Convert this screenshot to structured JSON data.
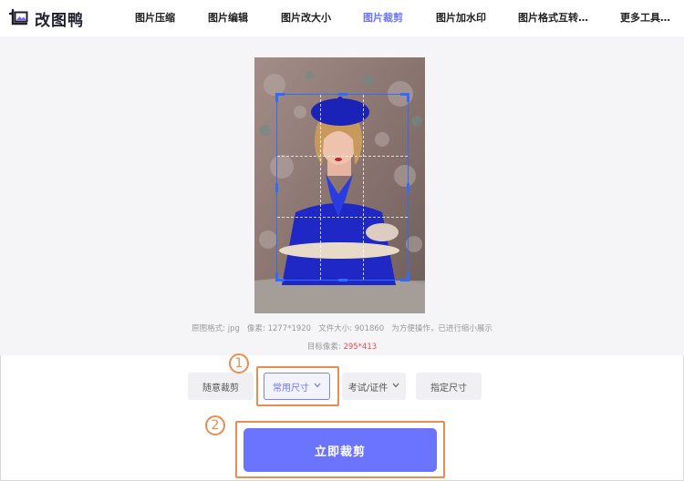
{
  "brand": {
    "name": "改图鸭",
    "accent_color": "#6b74ff"
  },
  "nav": [
    {
      "label": "图片压缩",
      "active": false
    },
    {
      "label": "图片编辑",
      "active": false
    },
    {
      "label": "图片改大小",
      "active": false
    },
    {
      "label": "图片裁剪",
      "active": true
    },
    {
      "label": "图片加水印",
      "active": false
    },
    {
      "label": "图片格式互转…",
      "active": false
    },
    {
      "label": "更多工具…",
      "active": false
    }
  ],
  "info": {
    "format_label": "原图格式:",
    "format_value": "jpg",
    "pixels_label": "像素:",
    "pixels_value": "1277*1920",
    "size_label": "文件大小:",
    "size_value": "901860",
    "note": "为方便操作，已进行缩小展示",
    "target_label": "目标像素:",
    "target_value": "295*413"
  },
  "options": [
    {
      "label": "随意裁剪",
      "has_dropdown": false,
      "selected": false
    },
    {
      "label": "常用尺寸",
      "has_dropdown": true,
      "selected": true
    },
    {
      "label": "考试/证件",
      "has_dropdown": true,
      "selected": false
    },
    {
      "label": "指定尺寸",
      "has_dropdown": false,
      "selected": false
    }
  ],
  "annotations": {
    "step1": "1",
    "step2": "2",
    "color": "#f08b4f"
  },
  "cta": {
    "label": "立即裁剪"
  },
  "icons": {
    "dropdown": "chevron-down-icon",
    "logo": "image-frame-logo-icon"
  }
}
